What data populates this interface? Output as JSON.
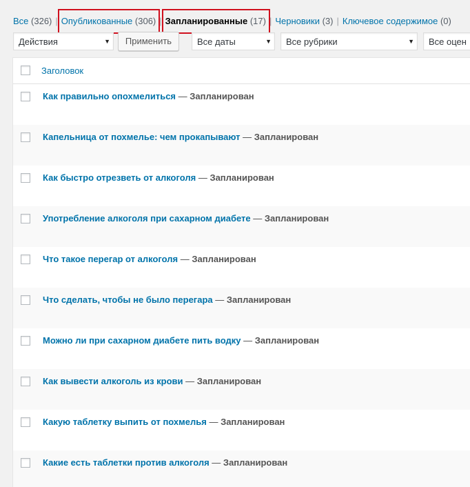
{
  "views": {
    "all_label": "Все",
    "all_count": "(326)",
    "publish_label": "Опубликованные",
    "publish_count": "(306)",
    "future_label": "Запланированные",
    "future_count": "(17)",
    "draft_label": "Черновики",
    "draft_count": "(3)",
    "cornerstone_label": "Ключевое содержимое",
    "cornerstone_count": "(0)",
    "separator": "|"
  },
  "filters": {
    "bulk_actions": "Действия",
    "apply_button": "Применить",
    "dates": "Все даты",
    "categories": "Все рубрики",
    "ratings": "Все оцен"
  },
  "table": {
    "title_header": "Заголовок",
    "state_separator": " — ",
    "rows": [
      {
        "title": "Как правильно опохмелиться",
        "state": "Запланирован"
      },
      {
        "title": "Капельница от похмелье: чем прокапывают",
        "state": "Запланирован"
      },
      {
        "title": "Как быстро отрезветь от алкоголя",
        "state": "Запланирован"
      },
      {
        "title": "Употребление алкоголя при сахарном диабете",
        "state": "Запланирован"
      },
      {
        "title": "Что такое перегар от алкоголя",
        "state": "Запланирован"
      },
      {
        "title": "Что сделать, чтобы не было перегара",
        "state": "Запланирован"
      },
      {
        "title": "Можно ли при сахарном диабете пить водку",
        "state": "Запланирован"
      },
      {
        "title": "Как вывести алкоголь из крови",
        "state": "Запланирован"
      },
      {
        "title": "Какую таблетку выпить от похмелья",
        "state": "Запланирован"
      },
      {
        "title": "Какие есть таблетки против алкоголя",
        "state": "Запланирован"
      }
    ]
  },
  "icons": {
    "dropdown_arrow": "▼"
  },
  "colors": {
    "link": "#0073aa",
    "highlight_box": "#d0101e",
    "row_alt": "#f9f9f9"
  }
}
